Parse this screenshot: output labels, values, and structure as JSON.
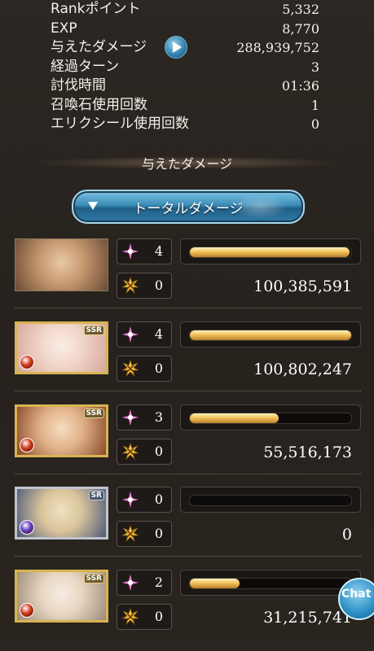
{
  "stats": [
    {
      "label": "Rankポイント",
      "value": "5,332"
    },
    {
      "label": "EXP",
      "value": "8,770"
    },
    {
      "label": "与えたダメージ",
      "value": "288,939,752"
    },
    {
      "label": "経過ターン",
      "value": "3"
    },
    {
      "label": "討伐時間",
      "value": "01:36"
    },
    {
      "label": "召喚石使用回数",
      "value": "1"
    },
    {
      "label": "エリクシール使用回数",
      "value": "0"
    }
  ],
  "section_title": "与えたダメージ",
  "total_button_label": "トータルダメージ",
  "members": [
    {
      "rarity": "",
      "element": "",
      "skill_count": "4",
      "other_count": "0",
      "damage": "100,385,591",
      "bar_fraction": 0.99
    },
    {
      "rarity": "SSR",
      "element": "fire",
      "skill_count": "4",
      "other_count": "0",
      "damage": "100,802,247",
      "bar_fraction": 1.0
    },
    {
      "rarity": "SSR",
      "element": "fire",
      "skill_count": "3",
      "other_count": "0",
      "damage": "55,516,173",
      "bar_fraction": 0.55
    },
    {
      "rarity": "SR",
      "element": "dark",
      "skill_count": "0",
      "other_count": "0",
      "damage": "0",
      "bar_fraction": 0.0
    },
    {
      "rarity": "SSR",
      "element": "fire",
      "skill_count": "2",
      "other_count": "0",
      "damage": "31,215,741",
      "bar_fraction": 0.31
    }
  ],
  "chat_label": "Chat",
  "colors": {
    "bar_fill": "#f2c25a",
    "accent_blue": "#3a8cb7",
    "fire": "#d23a1c",
    "dark": "#6a3fc2"
  },
  "icons": [
    "play-icon",
    "dropdown-triangle-icon",
    "sparkle-icon",
    "burst-icon",
    "fire-element-icon",
    "dark-element-icon",
    "chat-icon"
  ]
}
